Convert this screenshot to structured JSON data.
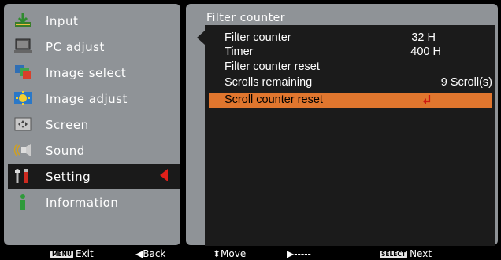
{
  "sidebar": {
    "items": [
      {
        "label": "Input",
        "icon": "input-icon"
      },
      {
        "label": "PC adjust",
        "icon": "pc-adjust-icon"
      },
      {
        "label": "Image select",
        "icon": "image-select-icon"
      },
      {
        "label": "Image adjust",
        "icon": "image-adjust-icon"
      },
      {
        "label": "Screen",
        "icon": "screen-icon"
      },
      {
        "label": "Sound",
        "icon": "sound-icon"
      },
      {
        "label": "Setting",
        "icon": "setting-icon"
      },
      {
        "label": "Information",
        "icon": "information-icon"
      }
    ],
    "active_index": 6
  },
  "panel": {
    "title": "Filter counter",
    "rows": [
      {
        "name": "Filter counter",
        "value": "32 H"
      },
      {
        "name": "Timer",
        "value": "400 H"
      },
      {
        "name": "Filter counter reset",
        "value": ""
      },
      {
        "name": "Scrolls remaining",
        "value": "9 Scroll(s)"
      },
      {
        "name": "Scroll counter reset",
        "value": ""
      }
    ],
    "selected_index": 4
  },
  "footer": {
    "exit_key": "MENU",
    "exit_label": "Exit",
    "back_label": "◀Back",
    "move_label": "⬍Move",
    "next_dash": "▶-----",
    "select_key": "SELECT",
    "next_label": "Next"
  },
  "colors": {
    "panel_bg": "#8f9397",
    "content_bg": "#1b1b1b",
    "highlight": "#e0762e",
    "accent_red": "#e0201a"
  }
}
